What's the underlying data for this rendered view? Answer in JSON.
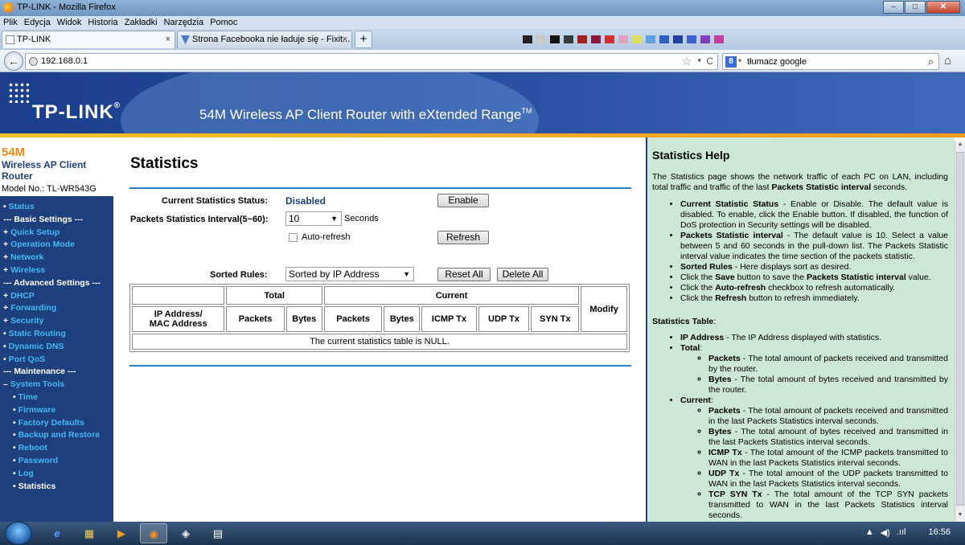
{
  "window": {
    "title": "TP-LINK - Mozilla Firefox",
    "minimize": "–",
    "maximize": "□",
    "close": "✕"
  },
  "menubar": [
    "Plik",
    "Edycja",
    "Widok",
    "Historia",
    "Zakładki",
    "Narzędzia",
    "Pomoc"
  ],
  "tabs": [
    {
      "label": "TP-LINK",
      "close": "×"
    },
    {
      "label": "Strona Facebooka nie ładuje się - Fixit...",
      "close": "×"
    }
  ],
  "newtab": "+",
  "nav": {
    "back": "←",
    "url": "192.168.0.1",
    "star": "☆",
    "drop": "▾",
    "reload": "C",
    "search_engine": "8",
    "search_drop": "▾",
    "search_text": "tłumacz google",
    "search_icon": "⌕",
    "home": "⌂"
  },
  "router_header": {
    "logo": "TP-LINK",
    "reg": "®",
    "model_title": "54M Wireless AP Client Router with eXtended Range",
    "tm": "TM"
  },
  "sidebar": {
    "title_big": "54M",
    "title_sub": "Wireless AP Client Router",
    "model": "Model No.: TL-WR543G",
    "items": [
      {
        "label": "Status",
        "type": "dot"
      },
      {
        "label": "--- Basic Settings ---",
        "type": "sec"
      },
      {
        "label": "Quick Setup",
        "type": "plus"
      },
      {
        "label": "Operation Mode",
        "type": "plus"
      },
      {
        "label": "Network",
        "type": "plus"
      },
      {
        "label": "Wireless",
        "type": "plus"
      },
      {
        "label": "--- Advanced Settings ---",
        "type": "sec"
      },
      {
        "label": "DHCP",
        "type": "plus"
      },
      {
        "label": "Forwarding",
        "type": "plus"
      },
      {
        "label": "Security",
        "type": "plus"
      },
      {
        "label": "Static Routing",
        "type": "dot"
      },
      {
        "label": "Dynamic DNS",
        "type": "dot"
      },
      {
        "label": "Port QoS",
        "type": "dot"
      },
      {
        "label": "--- Maintenance ---",
        "type": "sec"
      },
      {
        "label": "System Tools",
        "type": "minus"
      },
      {
        "label": "Time",
        "type": "sub"
      },
      {
        "label": "Firmware",
        "type": "sub"
      },
      {
        "label": "Factory Defaults",
        "type": "sub"
      },
      {
        "label": "Backup and Restore",
        "type": "sub"
      },
      {
        "label": "Reboot",
        "type": "sub"
      },
      {
        "label": "Password",
        "type": "sub"
      },
      {
        "label": "Log",
        "type": "sub"
      },
      {
        "label": "Statistics",
        "type": "subactive"
      }
    ]
  },
  "content": {
    "title": "Statistics",
    "status_label": "Current Statistics Status:",
    "status_value": "Disabled",
    "enable_button": "Enable",
    "interval_label": "Packets Statistics Interval(5~60):",
    "interval_value": "10",
    "interval_unit": "Seconds",
    "autorefresh_label": "Auto-refresh",
    "refresh_button": "Refresh",
    "sorted_label": "Sorted Rules:",
    "sorted_value": "Sorted by IP Address",
    "reset_button": "Reset All",
    "delete_button": "Delete All",
    "table": {
      "group_total": "Total",
      "group_current": "Current",
      "modify": "Modify",
      "ip_mac_1": "IP Address/",
      "ip_mac_2": "MAC Address",
      "cols": [
        "Packets",
        "Bytes",
        "Packets",
        "Bytes",
        "ICMP Tx",
        "UDP Tx",
        "SYN Tx"
      ],
      "null_text": "The current statistics table is NULL."
    }
  },
  "help": {
    "title": "Statistics Help",
    "intro_a": "The Statistics page shows the network traffic of each PC on LAN, including total traffic and traffic of the last ",
    "intro_b": "Packets Statistic interval",
    "intro_c": " seconds.",
    "items": [
      {
        "b": "Current Statistic Status",
        "t": " - Enable or Disable. The default value is disabled. To enable, click the Enable button. If disabled, the function of DoS protection in Security settings will be disabled."
      },
      {
        "b": "Packets Statistic interval",
        "t": " - The default value is 10. Select a value between 5 and 60 seconds in the pull-down list. The Packets Statistic interval value indicates the time section of the packets statistic."
      },
      {
        "b": "Sorted Rules",
        "t": " - Here displays sort as desired."
      }
    ],
    "save_a": "Click the ",
    "save_b": "Save",
    "save_c": " button to save the ",
    "save_d": "Packets Statistic interval",
    "save_e": " value.",
    "auto_a": "Click the ",
    "auto_b": "Auto-refresh",
    "auto_c": " checkbox to refresh automatically.",
    "ref_a": "Click the ",
    "ref_b": "Refresh",
    "ref_c": " button to refresh immediately.",
    "table_title": "Statistics Table",
    "table_colon": ":",
    "ip_b": "IP Address",
    "ip_t": " - The IP Address displayed with statistics.",
    "total_b": "Total",
    "total_colon": ":",
    "total_items": [
      {
        "b": "Packets",
        "t": " - The total amount of packets received and transmitted by the router."
      },
      {
        "b": "Bytes",
        "t": " - The total amount of bytes received and transmitted by the router."
      }
    ],
    "current_b": "Current",
    "current_colon": ":",
    "current_items": [
      {
        "b": "Packets",
        "t": " - The total amount of packets received and transmitted in the last Packets Statistics interval seconds."
      },
      {
        "b": "Bytes",
        "t": " - The total amount of bytes received and transmitted in the last Packets Statistics interval seconds."
      },
      {
        "b": "ICMP Tx",
        "t": " - The total amount of the ICMP packets transmitted to WAN in the last Packets Statistics interval seconds."
      },
      {
        "b": "UDP Tx",
        "t": " - The total amount of the UDP packets transmitted to WAN in the last Packets Statistics interval seconds."
      },
      {
        "b": "TCP SYN Tx",
        "t": " - The total amount of the TCP SYN packets transmitted to WAN in the last Packets Statistics interval seconds."
      }
    ]
  },
  "taskbar": {
    "ie": "e",
    "folder": "▦",
    "media": "▶",
    "firefox": "◉",
    "app5": "◈",
    "app6": "▤",
    "tray_arrow": "▲",
    "tray_net": ".ııl",
    "tray_vol": "◀)",
    "clock": "16:56"
  },
  "scroll": {
    "up": "▲",
    "down": "▼"
  },
  "colors": {
    "router_blue": "#1e3f7e",
    "menu_link": "#45b7f5",
    "accent_orange": "#f08a12",
    "help_bg": "#cce7d6",
    "rule_blue": "#2a7dc3"
  }
}
